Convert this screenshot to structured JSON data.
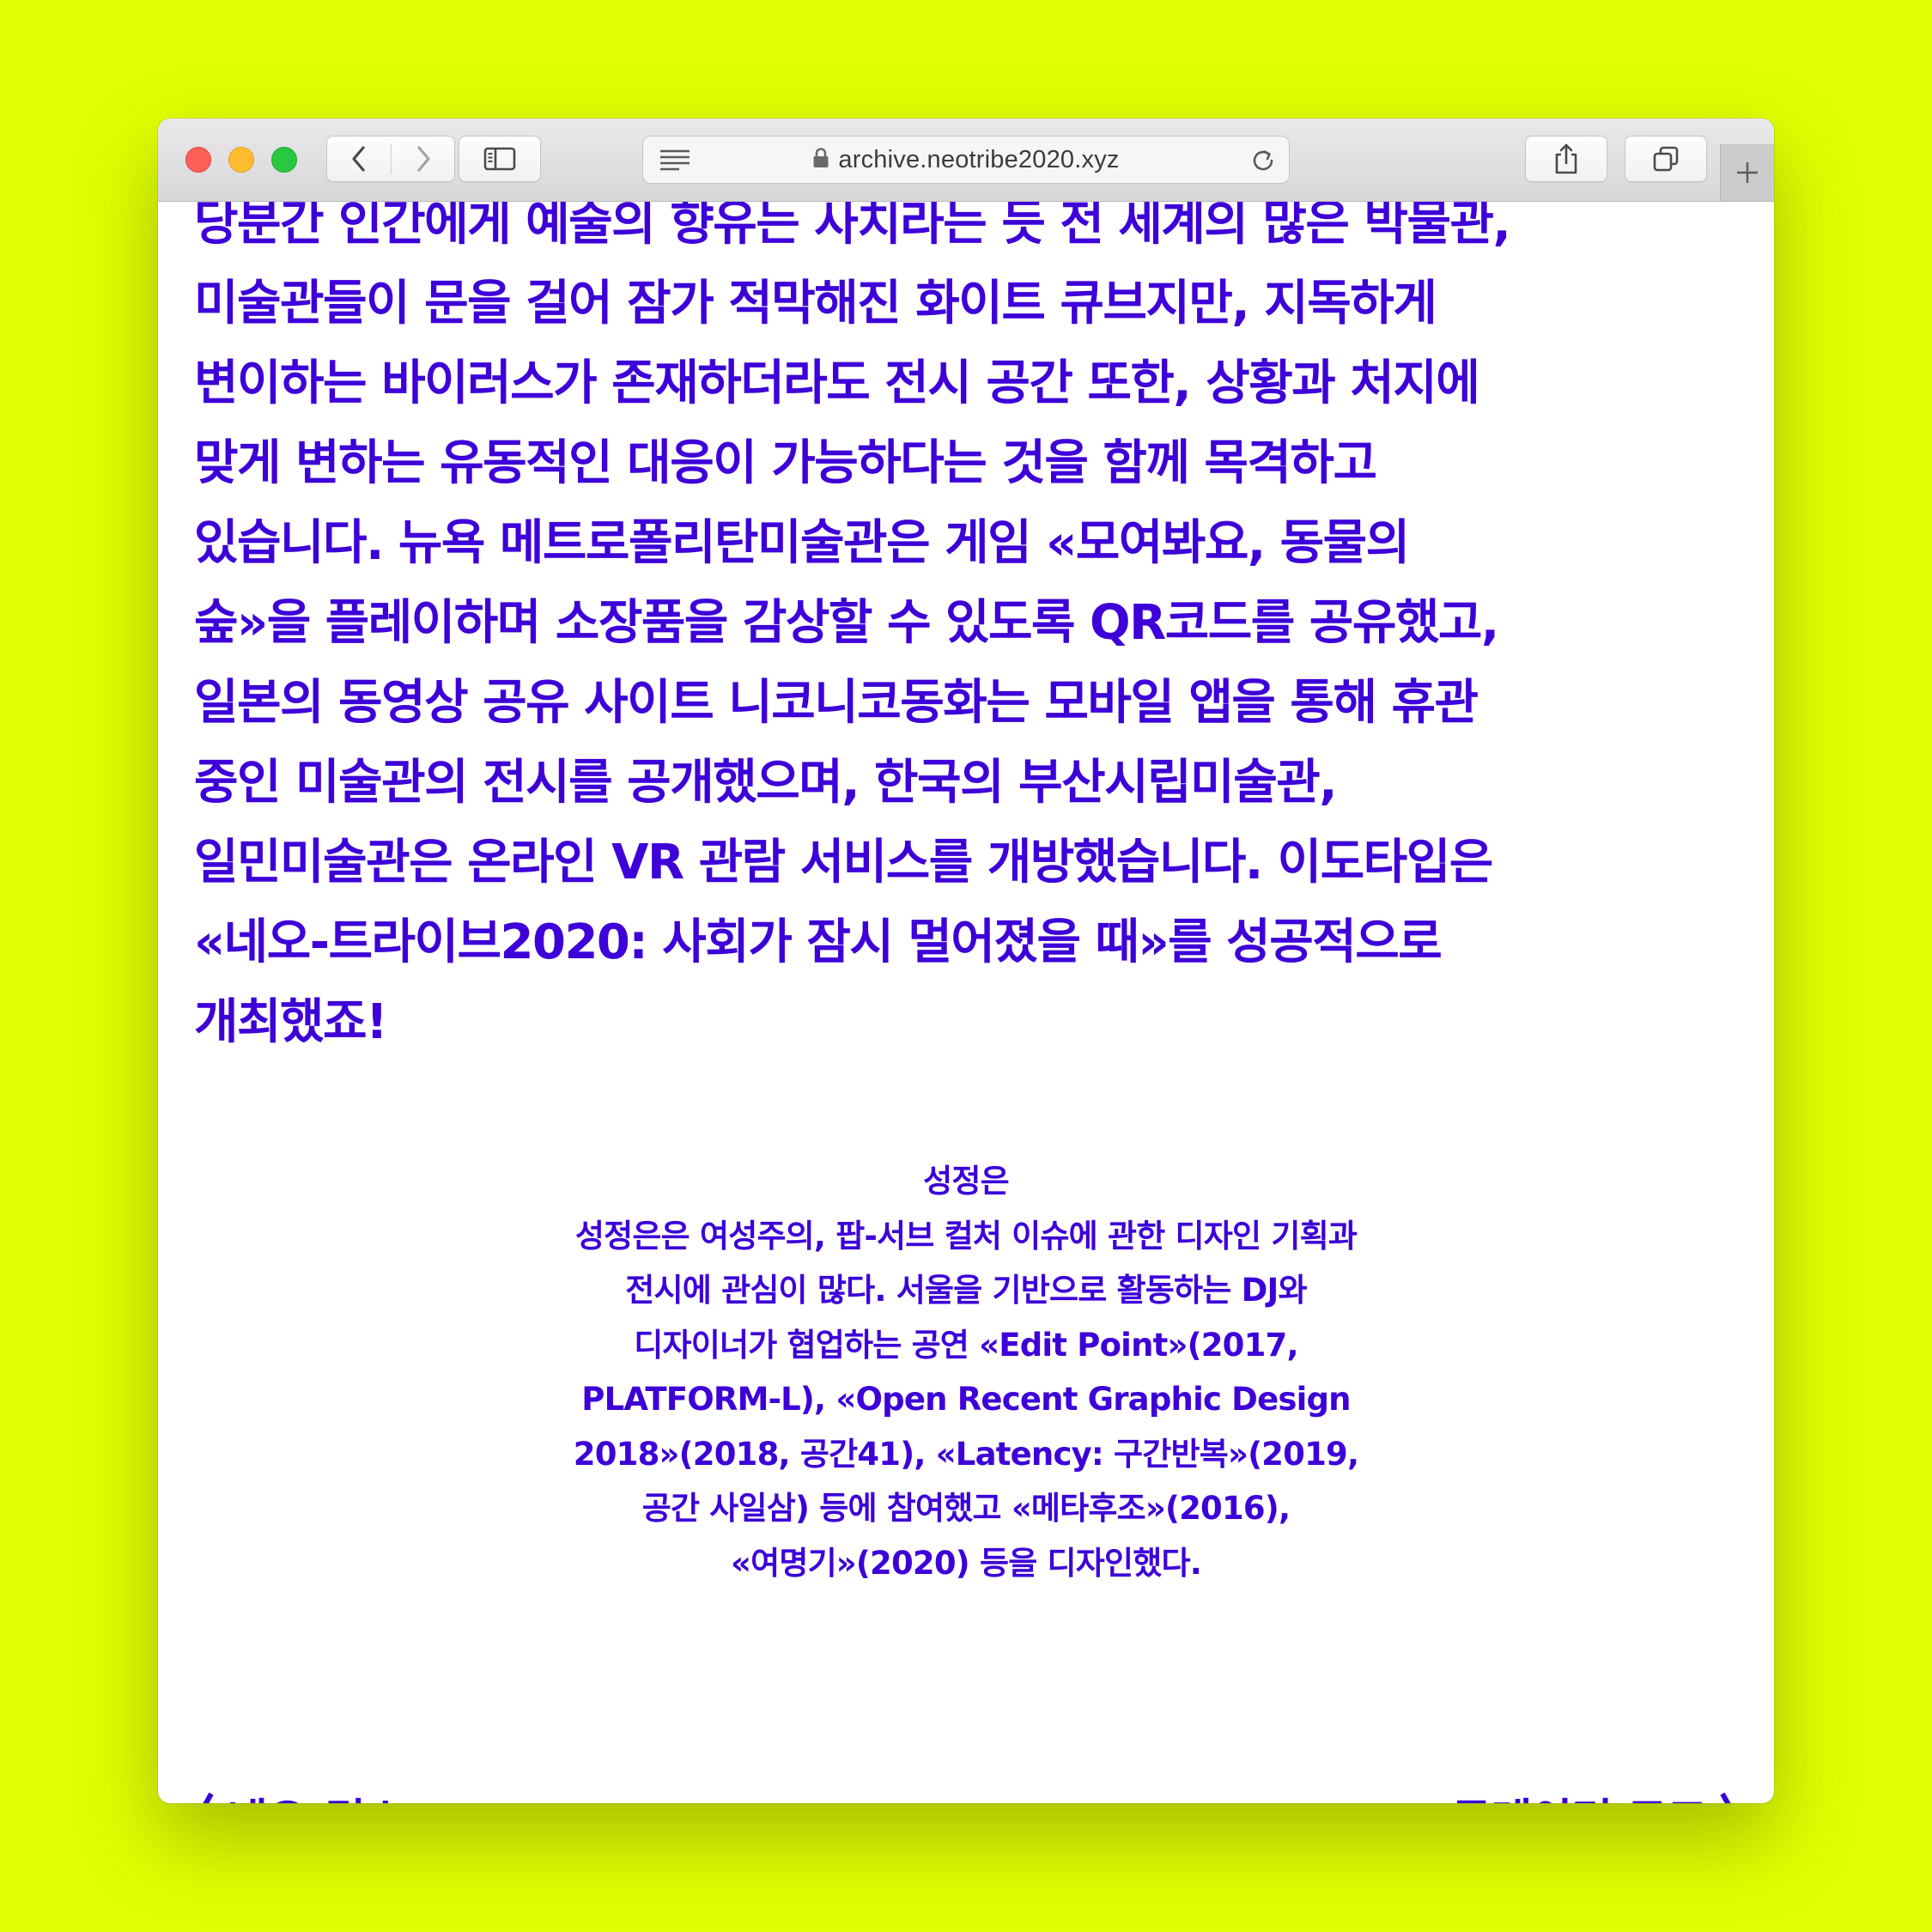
{
  "browser": {
    "url": "archive.neotribe2020.xyz"
  },
  "article": {
    "lines": [
      "당분간 인간에게 예술의 향유는 사치라는 듯 전 세계의 많은 박물관,",
      "미술관들이 문을 걸어 잠가 적막해진 화이트 큐브지만, 지독하게",
      "변이하는 바이러스가 존재하더라도 전시 공간 또한, 상황과 처지에",
      "맞게 변하는 유동적인 대응이 가능하다는 것을 함께 목격하고",
      "있습니다. 뉴욕 메트로폴리탄미술관은 게임 «모여봐요, 동물의",
      "숲»을 플레이하며 소장품을 감상할 수 있도록 QR코드를 공유했고,",
      "일본의 동영상 공유 사이트 니코니코동화는 모바일 앱을 통해 휴관",
      "중인 미술관의 전시를 공개했으며, 한국의 부산시립미술관,",
      "일민미술관은 온라인 VR 관람 서비스를 개방했습니다. 이도타입은",
      "«네오-트라이브2020: 사회가 잠시 멀어졌을 때»를 성공적으로",
      "개최했죠!"
    ]
  },
  "bio": {
    "name": "성정은",
    "lines": [
      "성정은은 여성주의, 팝-서브 컬처 이슈에 관한 디자인 기획과",
      "전시에 관심이 많다. 서울을 기반으로 활동하는 DJ와",
      "디자이너가 협업하는 공연 «Edit Point»(2017,",
      "PLATFORM-L), «Open Recent Graphic Design",
      "2018»(2018, 공간41), «Latency: 구간반복»(2019,",
      "공간 사일삼) 등에 참여했고 «메타후조»(2016),",
      "«여명기»(2020) 등을 디자인했다."
    ]
  },
  "footer_nav": {
    "prev_label": "네오-믹스",
    "next_label": "큐레이터 토크"
  },
  "colors": {
    "background": "#e1ff00",
    "text": "#3d00d8",
    "window": "#ffffff"
  },
  "icons": {
    "back": "chevron-left-icon",
    "forward": "chevron-right-icon",
    "sidebar": "sidebar-icon",
    "reader": "reader-icon",
    "lock": "lock-icon",
    "reload": "reload-icon",
    "share": "share-icon",
    "tabs": "tabs-icon",
    "new_tab": "plus-icon",
    "prev": "angle-left-icon",
    "next": "angle-right-icon"
  }
}
